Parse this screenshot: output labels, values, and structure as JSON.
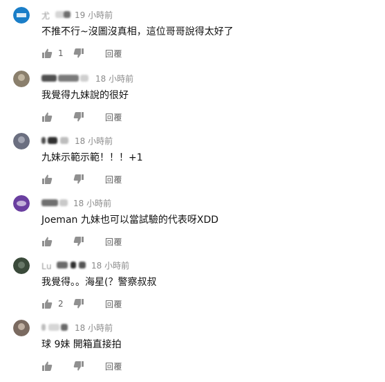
{
  "reply_label": "回覆",
  "comments": [
    {
      "author": "尤",
      "time": "19 小時前",
      "text": "不推不行~沒圖沒真相，這位哥哥說得太好了",
      "likes": "1",
      "avatar_color": "#1a7ec8"
    },
    {
      "author": "",
      "time": "18 小時前",
      "text": "我覺得九妹說的很好",
      "likes": "",
      "avatar_color": "#8a7f6c"
    },
    {
      "author": "",
      "time": "18 小時前",
      "text": "九妹示範示範！！！+1",
      "likes": "",
      "avatar_color": "#6b6f80"
    },
    {
      "author": "",
      "time": "18 小時前",
      "text": "Joeman 九妹也可以當試驗的代表呀XDD",
      "likes": "",
      "avatar_color": "#6a3fa0"
    },
    {
      "author": "Lu",
      "time": "18 小時前",
      "text": "我覺得。。海星(？警察叔叔",
      "likes": "2",
      "avatar_color": "#3a4a3a"
    },
    {
      "author": "",
      "time": "18 小時前",
      "text": "球 9妹 開箱直接拍",
      "likes": "",
      "avatar_color": "#7a6a60"
    }
  ]
}
